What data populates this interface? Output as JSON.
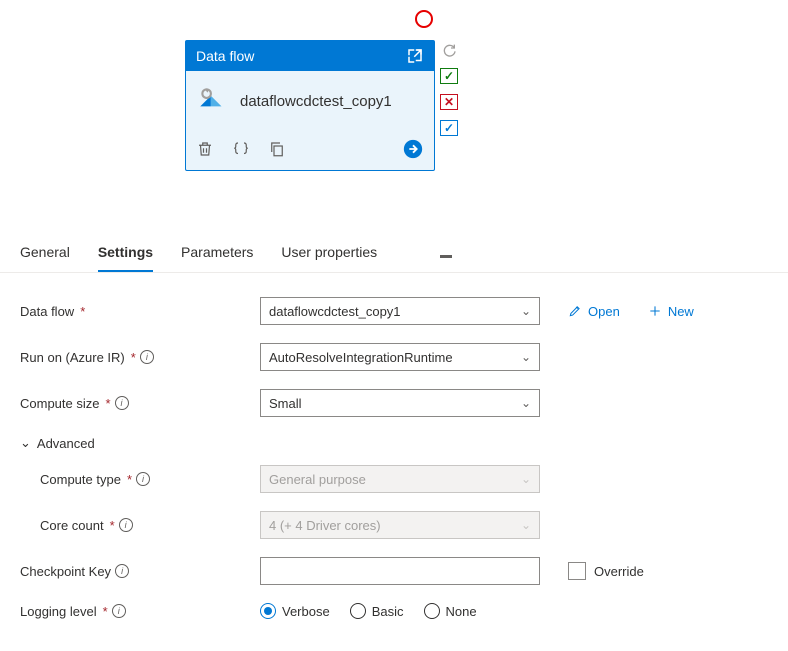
{
  "node": {
    "header_title": "Data flow",
    "name": "dataflowcdctest_copy1"
  },
  "tabs": [
    {
      "label": "General"
    },
    {
      "label": "Settings"
    },
    {
      "label": "Parameters"
    },
    {
      "label": "User properties"
    }
  ],
  "active_tab": "Settings",
  "form": {
    "dataflow_label": "Data flow",
    "dataflow_value": "dataflowcdctest_copy1",
    "open_label": "Open",
    "new_label": "New",
    "runon_label": "Run on (Azure IR)",
    "runon_value": "AutoResolveIntegrationRuntime",
    "computesize_label": "Compute size",
    "computesize_value": "Small",
    "advanced_label": "Advanced",
    "computetype_label": "Compute type",
    "computetype_value": "General purpose",
    "corecount_label": "Core count",
    "corecount_value": "4 (+ 4 Driver cores)",
    "checkpoint_label": "Checkpoint Key",
    "checkpoint_value": "",
    "override_label": "Override",
    "logging_label": "Logging level",
    "logging_options": [
      "Verbose",
      "Basic",
      "None"
    ],
    "logging_selected": "Verbose"
  }
}
